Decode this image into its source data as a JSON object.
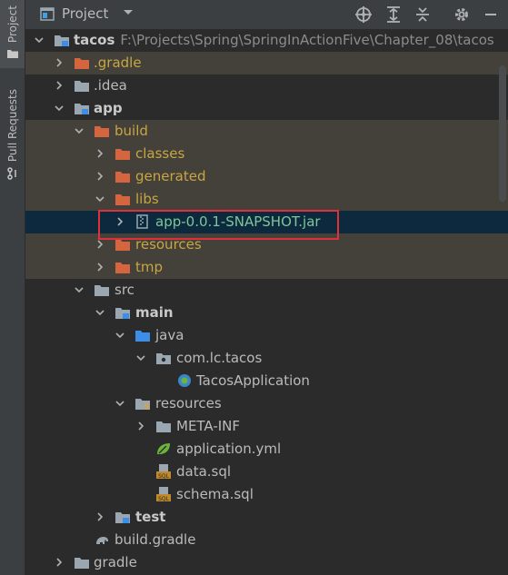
{
  "sidebar": {
    "project_tab": "Project",
    "pull_requests_tab": "Pull Requests"
  },
  "header": {
    "title": "Project"
  },
  "tree": {
    "root_name": "tacos",
    "root_path": "F:\\Projects\\Spring\\SpringInActionFive\\Chapter_08\\tacos",
    "items": [
      {
        "label": ".gradle"
      },
      {
        "label": ".idea"
      },
      {
        "label": "app"
      },
      {
        "label": "build"
      },
      {
        "label": "classes"
      },
      {
        "label": "generated"
      },
      {
        "label": "libs"
      },
      {
        "label": "app-0.0.1-SNAPSHOT.jar"
      },
      {
        "label": "resources"
      },
      {
        "label": "tmp"
      },
      {
        "label": "src"
      },
      {
        "label": "main"
      },
      {
        "label": "java"
      },
      {
        "label": "com.lc.tacos"
      },
      {
        "label": "TacosApplication"
      },
      {
        "label": "resources"
      },
      {
        "label": "META-INF"
      },
      {
        "label": "application.yml"
      },
      {
        "label": "data.sql"
      },
      {
        "label": "schema.sql"
      },
      {
        "label": "test"
      },
      {
        "label": "build.gradle"
      },
      {
        "label": "gradle"
      }
    ]
  },
  "colors": {
    "excluded_text": "#c8a642",
    "excluded_row": "#44403a",
    "selected_row": "#0d293e",
    "highlight_box": "#e0303a"
  }
}
